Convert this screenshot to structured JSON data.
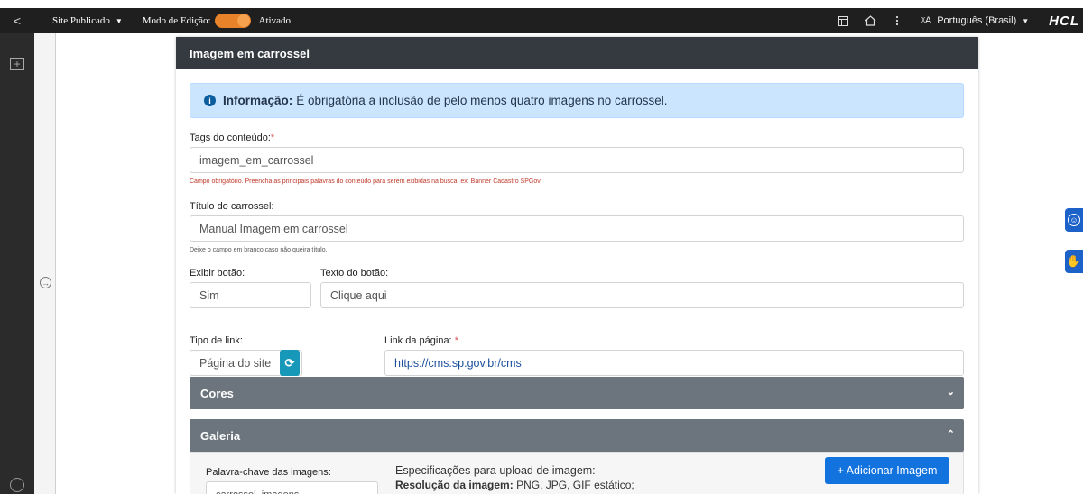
{
  "topbar": {
    "back_glyph": "<",
    "site_label": "Site Publicado",
    "edit_mode_label": "Modo de Edição:",
    "edit_status": "Ativado",
    "language": "Português (Brasil)",
    "brand": "HCL",
    "icons": [
      "layout-icon",
      "home-icon",
      "more-icon",
      "translate-icon"
    ]
  },
  "card": {
    "title": "Imagem em carrossel",
    "info": {
      "bold": "Informação:",
      "text": "É obrigatória a inclusão de pelo menos quatro imagens no carrossel."
    },
    "tags": {
      "label": "Tags do conteúdo:",
      "required_mark": "*",
      "value": "imagem_em_carrossel",
      "hint": "Campo obrigatório. Preencha as principais palavras do conteúdo para serem exibidas na busca. ex: Banner Cadastro SPGov."
    },
    "title_field": {
      "label": "Título do carrossel:",
      "value": "Manual Imagem em carrossel",
      "hint": "Deixe o campo em branco caso não queira título."
    },
    "show_button": {
      "label": "Exibir botão:",
      "value": "Sim"
    },
    "button_text": {
      "label": "Texto do botão:",
      "value": "Clique aqui"
    },
    "link_type": {
      "label": "Tipo de link:",
      "value": "Página do site",
      "refresh_glyph": "⟳"
    },
    "page_link": {
      "label": "Link da página:",
      "required_mark": "*",
      "value": "https://cms.sp.gov.br/cms"
    },
    "sections": {
      "colors": "Cores",
      "gallery": "Galeria"
    },
    "gallery": {
      "keyword_label": "Palavra-chave das imagens:",
      "keyword_value": "carrossel_imagens",
      "spec_title": "Especificações para upload de imagem:",
      "spec_resolution_bold": "Resolução da imagem:",
      "spec_resolution_value": "PNG, JPG, GIF estático;",
      "add_button": "+ Adicionar Imagem"
    }
  },
  "colors": {
    "topbar": "#1f1f1f",
    "toggle": "#e8832a",
    "card_header": "#343a40",
    "accordion": "#6c757d",
    "info_bg": "#cce5ff",
    "primary_button": "#1272de",
    "refresh_button": "#1798b8"
  }
}
